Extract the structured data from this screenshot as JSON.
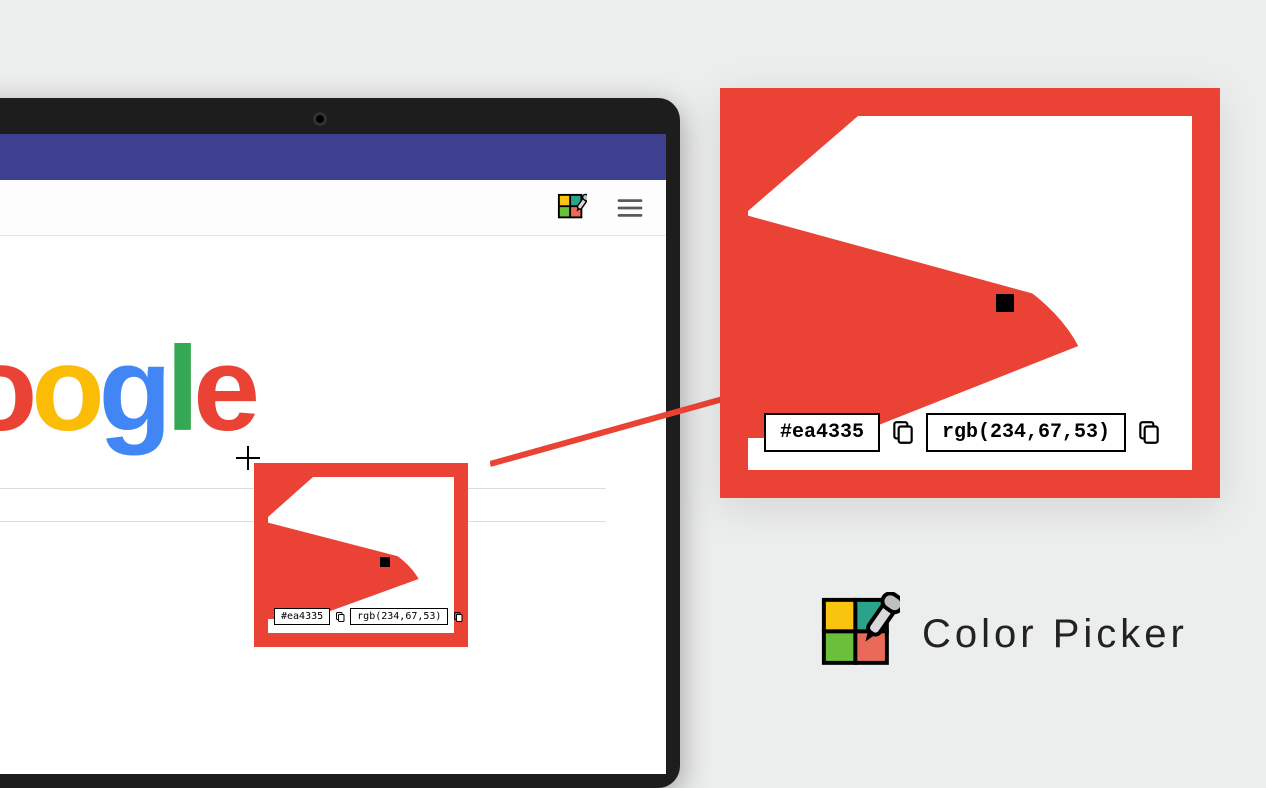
{
  "browser": {
    "titlebar_color": "#3d3f8f"
  },
  "logo": {
    "chars": [
      "o",
      "o",
      "g",
      "l",
      "e"
    ],
    "colors": [
      "#ea4335",
      "#fbbc05",
      "#4285f4",
      "#34a853",
      "#ea4335"
    ]
  },
  "picker": {
    "picked_color": "#ea4335",
    "hex": "#ea4335",
    "rgb": "rgb(234,67,53)"
  },
  "mini": {
    "hex": "#ea4335",
    "rgb": "rgb(234,67,53)"
  },
  "product": {
    "name": "Color Picker"
  }
}
